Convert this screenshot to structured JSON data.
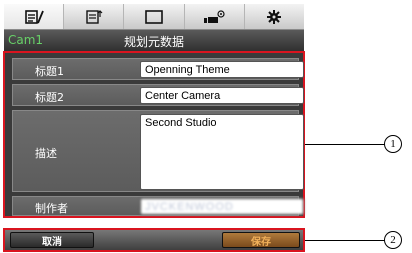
{
  "tabs": [
    {
      "icon": "metadata-edit-icon"
    },
    {
      "icon": "upload-document-icon"
    },
    {
      "icon": "monitor-icon"
    },
    {
      "icon": "camera-settings-icon"
    },
    {
      "icon": "gear-icon"
    }
  ],
  "titlebar": {
    "camera": "Cam1",
    "title": "规划元数据"
  },
  "form": {
    "fields": [
      {
        "label": "标题1",
        "value": "Openning Theme"
      },
      {
        "label": "标题2",
        "value": "Center Camera"
      },
      {
        "label": "描述",
        "value": "Second Studio"
      },
      {
        "label": "制作者",
        "value": "JVCKENWOOD"
      }
    ]
  },
  "buttons": {
    "cancel": "取消",
    "save": "保存"
  },
  "callouts": [
    "1",
    "2"
  ],
  "colors": {
    "highlight": "#d9141f",
    "camera_label": "#68d068",
    "save_text": "#f2b15a"
  }
}
